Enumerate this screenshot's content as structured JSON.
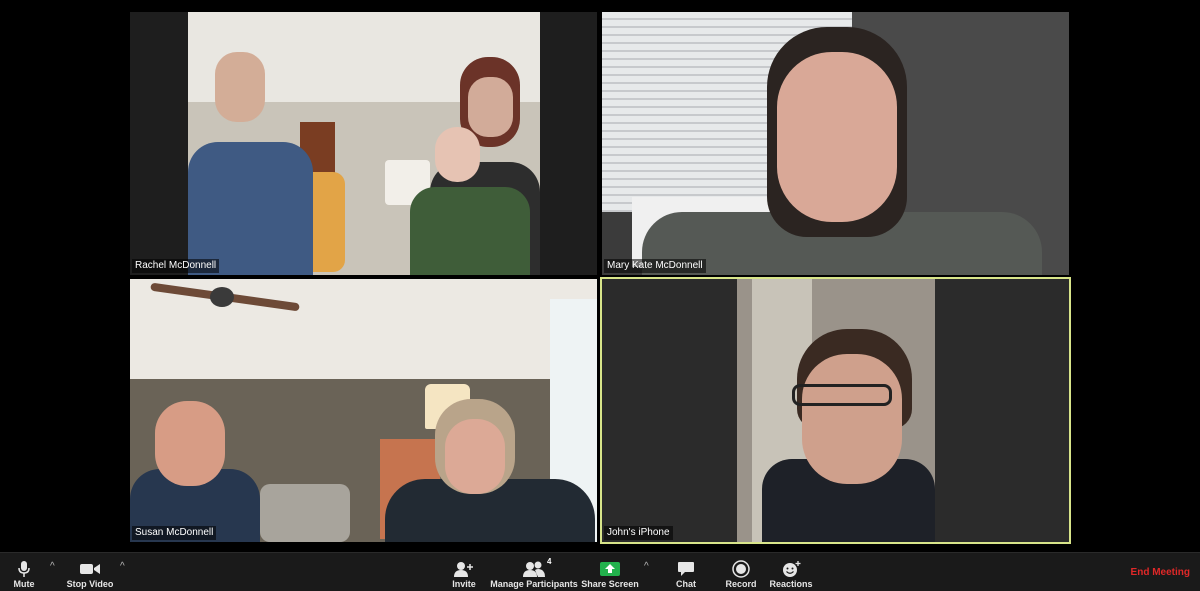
{
  "participants": [
    {
      "name": "Rachel McDonnell"
    },
    {
      "name": "Mary Kate McDonnell"
    },
    {
      "name": "Susan McDonnell"
    },
    {
      "name": "John's iPhone",
      "active_speaker": true
    }
  ],
  "toolbar": {
    "mute_label": "Mute",
    "stop_video_label": "Stop Video",
    "invite_label": "Invite",
    "manage_participants_label": "Manage Participants",
    "participant_count": "4",
    "share_screen_label": "Share Screen",
    "chat_label": "Chat",
    "record_label": "Record",
    "reactions_label": "Reactions",
    "end_meeting_label": "End Meeting"
  },
  "colors": {
    "active_speaker_border": "#d8e58a",
    "share_green": "#22b14c",
    "end_red": "#e02828"
  }
}
